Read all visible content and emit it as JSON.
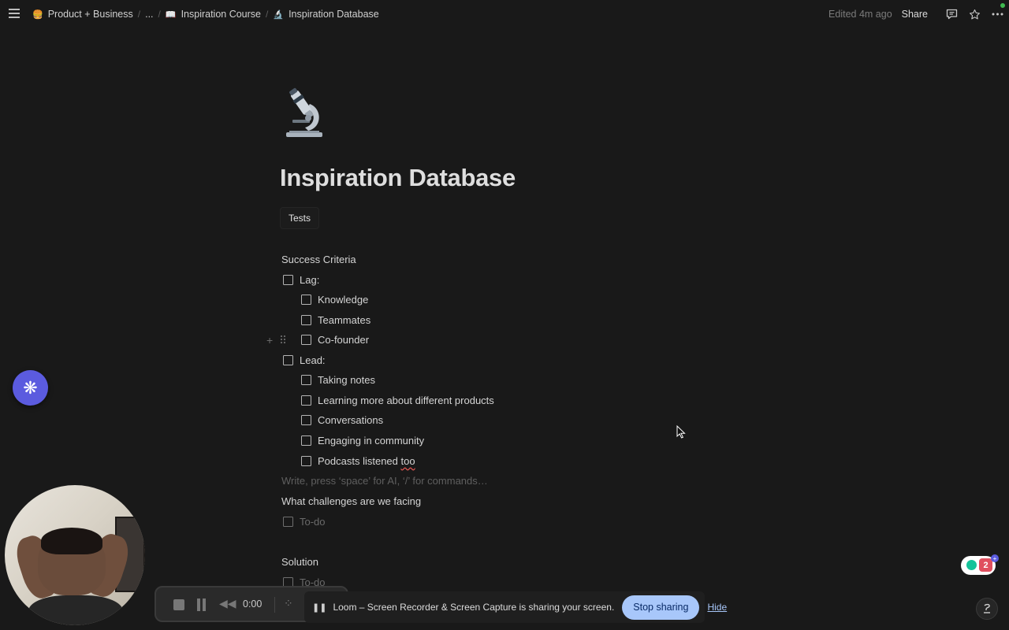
{
  "topbar": {
    "breadcrumbs": [
      {
        "label": "Product + Business",
        "icon": "stack-emoji"
      },
      {
        "label": "..."
      },
      {
        "label": "Inspiration Course",
        "icon": "book-emoji"
      },
      {
        "label": "Inspiration Database",
        "icon": "microscope-emoji"
      }
    ],
    "edited": "Edited 4m ago",
    "share_label": "Share",
    "icons": [
      "comment-icon",
      "star-icon",
      "more-icon"
    ]
  },
  "page": {
    "icon": "microscope-emoji",
    "title": "Inspiration Database",
    "tab_label": "Tests",
    "success_heading": "Success Criteria",
    "lag": {
      "label": "Lag:",
      "items": [
        "Knowledge",
        "Teammates",
        "Co-founder"
      ]
    },
    "lead": {
      "label": "Lead:",
      "items": [
        "Taking notes",
        "Learning more about different products",
        "Conversations",
        "Engaging in community",
        "Podcasts listened too"
      ]
    },
    "placeholder": "Write, press ‘space’ for AI, ‘/’ for commands…",
    "challenges_heading": "What challenges are we facing",
    "challenges_todo": "To-do",
    "solution_heading": "Solution",
    "solution_todo": "To-do"
  },
  "recorder": {
    "time": "0:00"
  },
  "share_banner": {
    "message": "Loom – Screen Recorder & Screen Capture is sharing your screen.",
    "stop_label": "Stop sharing",
    "hide_label": "Hide"
  },
  "grammarly": {
    "count": "2"
  },
  "colors": {
    "background": "#191919",
    "accent_purple": "#5b5bdf",
    "stop_button": "#a8c7fa",
    "grammarly_red": "#e04f5f",
    "grammarly_green": "#15c39a"
  }
}
